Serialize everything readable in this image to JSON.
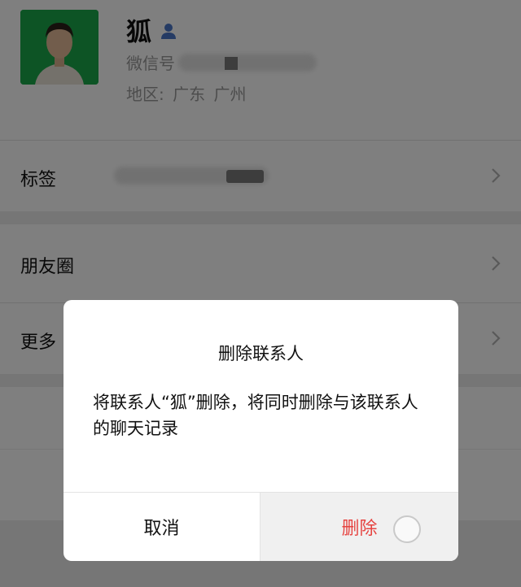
{
  "profile": {
    "name": "狐",
    "wechat_id_label": "微信号",
    "region_label": "地区:",
    "region_value": "广东  广州",
    "icons": [
      "avatar",
      "person-icon"
    ]
  },
  "rows": {
    "tags_label": "标签",
    "moments_label": "朋友圈",
    "more_label": "更多"
  },
  "dialog": {
    "title": "删除联系人",
    "message": "将联系人“狐”删除，将同时删除与该联系人的聊天记录",
    "cancel_label": "取消",
    "delete_label": "删除"
  },
  "colors": {
    "delete_red": "#e64340",
    "avatar_bg": "#1aa84a",
    "person_icon_blue": "#4a77c8"
  }
}
